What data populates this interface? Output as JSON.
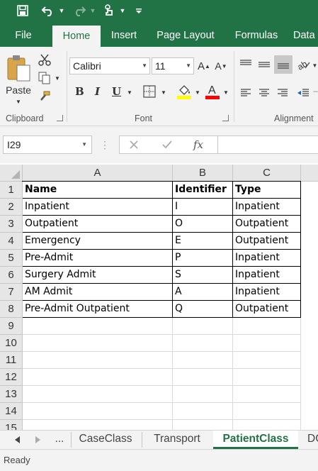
{
  "qat": {
    "save": "save-icon",
    "undo": "undo-icon",
    "redo": "redo-icon",
    "touch": "touch-mode-icon",
    "customize": "customize-icon"
  },
  "tabs": [
    {
      "label": "File"
    },
    {
      "label": "Home"
    },
    {
      "label": "Insert"
    },
    {
      "label": "Page Layout"
    },
    {
      "label": "Formulas"
    },
    {
      "label": "Data"
    }
  ],
  "ribbon": {
    "clipboard": {
      "paste_label": "Paste",
      "group_label": "Clipboard"
    },
    "font": {
      "font_name": "Calibri",
      "font_size": "11",
      "bold": "B",
      "italic": "I",
      "underline": "U",
      "group_label": "Font",
      "fill_color": "#ffff00",
      "font_color": "#ff0000"
    },
    "alignment": {
      "group_label": "Alignment"
    }
  },
  "formula_bar": {
    "name_box": "I29",
    "fx": "fx",
    "formula": ""
  },
  "columns": [
    "A",
    "B",
    "C"
  ],
  "rows": [
    "1",
    "2",
    "3",
    "4",
    "5",
    "6",
    "7",
    "8",
    "9",
    "10",
    "11",
    "12",
    "13",
    "14",
    "15"
  ],
  "table": {
    "headers": [
      "Name",
      "Identifier",
      "Type"
    ],
    "data": [
      [
        "Inpatient",
        "I",
        "Inpatient"
      ],
      [
        "Outpatient",
        "O",
        "Outpatient"
      ],
      [
        "Emergency",
        "E",
        "Outpatient"
      ],
      [
        "Pre-Admit",
        "P",
        "Inpatient"
      ],
      [
        "Surgery Admit",
        "S",
        "Inpatient"
      ],
      [
        "AM Admit",
        "A",
        "Inpatient"
      ],
      [
        "Pre-Admit Outpatient",
        "Q",
        "Outpatient"
      ]
    ]
  },
  "sheets": {
    "more": "...",
    "tabs": [
      {
        "label": "CaseClass"
      },
      {
        "label": "Transport"
      },
      {
        "label": "PatientClass"
      },
      {
        "label": "DC"
      }
    ]
  },
  "status": {
    "text": "Ready"
  },
  "colors": {
    "accent": "#217346"
  }
}
